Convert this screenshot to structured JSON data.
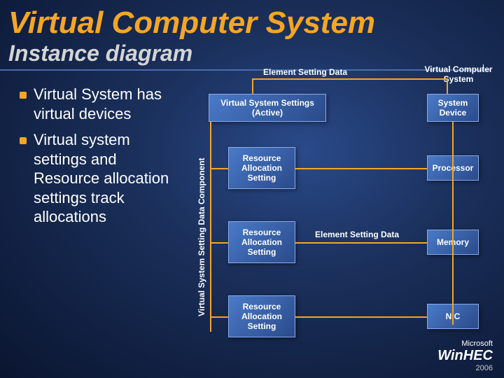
{
  "title": "Virtual Computer System",
  "subtitle": "Instance diagram",
  "bullets": [
    "Virtual System has virtual devices",
    "Virtual system settings and Resource allocation settings track allocations"
  ],
  "labels": {
    "top": "Element Setting Data",
    "topright": "Virtual Computer System",
    "vertical": "Virtual System Setting Data Component",
    "mid": "Element Setting Data"
  },
  "boxes": {
    "vss": "Virtual System Settings (Active)",
    "ras1": "Resource Allocation Setting",
    "ras2": "Resource Allocation Setting",
    "ras3": "Resource Allocation Setting",
    "sysdev": "System Device",
    "proc": "Processor",
    "mem": "Memory",
    "nic": "NIC"
  },
  "footer": {
    "company": "Microsoft",
    "brand": "WinHEC",
    "year": "2006"
  }
}
